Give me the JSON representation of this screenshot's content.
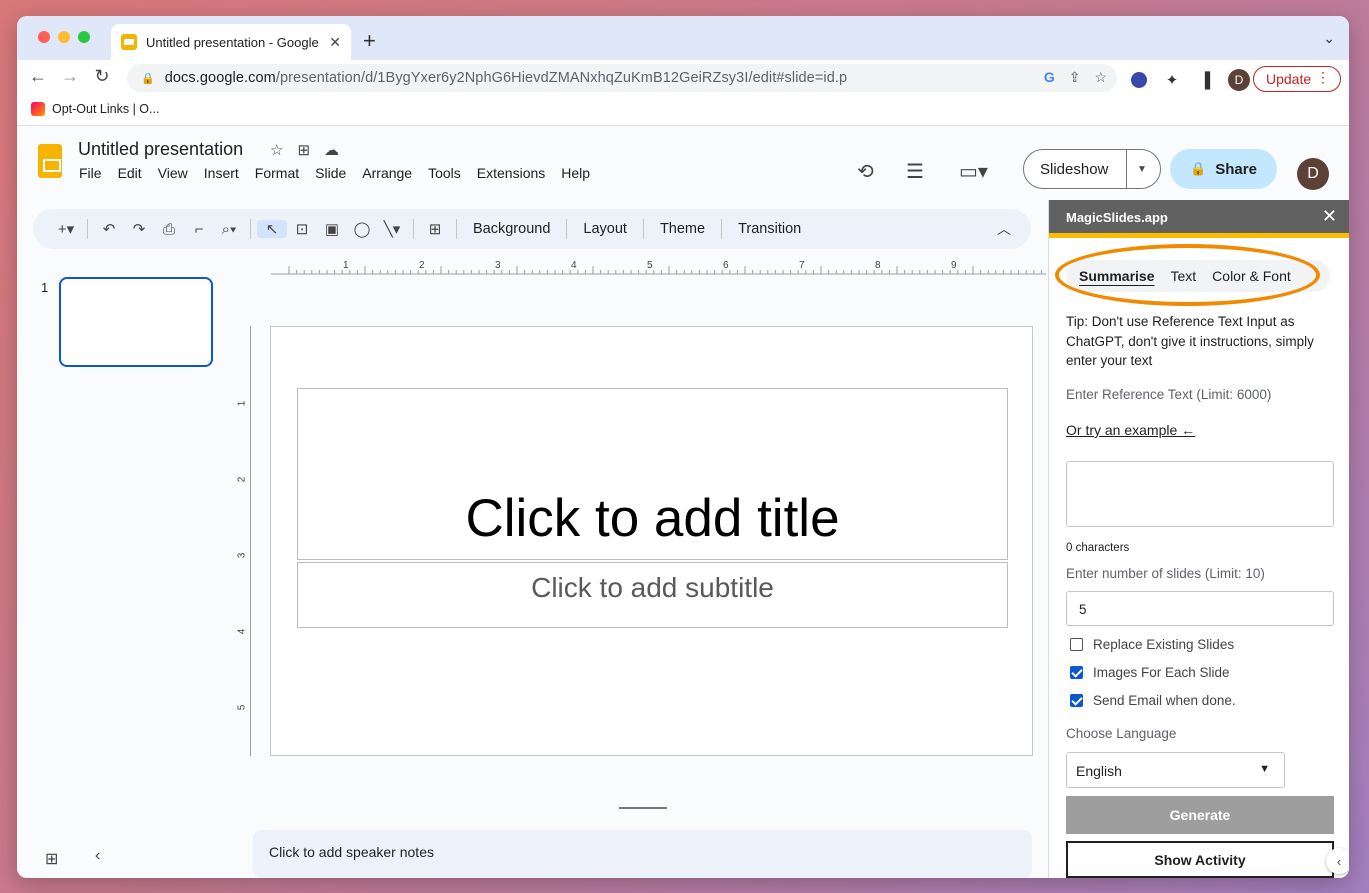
{
  "browser": {
    "tab_title": "Untitled presentation - Google",
    "url_domain": "docs.google.com",
    "url_path": "/presentation/d/1BygYxer6y2NphG6HievdZMANxhqZuKmB12GeiRZsy3I/edit#slide=id.p",
    "update_label": "Update",
    "profile_initial": "D",
    "bookmark_label": "Opt-Out Links | O..."
  },
  "slides": {
    "doc_title": "Untitled presentation",
    "menu": [
      "File",
      "Edit",
      "View",
      "Insert",
      "Format",
      "Slide",
      "Arrange",
      "Tools",
      "Extensions",
      "Help"
    ],
    "slideshow_label": "Slideshow",
    "share_label": "Share",
    "user_initial": "D",
    "toolbar": {
      "background": "Background",
      "layout": "Layout",
      "theme": "Theme",
      "transition": "Transition"
    },
    "slide_number": "1",
    "ruler_h": [
      "1",
      "2",
      "3",
      "4",
      "5",
      "6",
      "7",
      "8",
      "9"
    ],
    "ruler_v": [
      "1",
      "2",
      "3",
      "4",
      "5"
    ],
    "title_placeholder": "Click to add title",
    "subtitle_placeholder": "Click to add subtitle",
    "notes_placeholder": "Click to add speaker notes"
  },
  "panel": {
    "header": "MagicSlides.app",
    "tabs": [
      "Summarise",
      "Text",
      "Color & Font"
    ],
    "tip": "Tip: Don't use Reference Text Input as ChatGPT, don't give it instructions, simply enter your text",
    "ref_label": "Enter Reference Text (Limit: 6000)",
    "example_link": "Or try an example ←",
    "char_count": "0 characters",
    "slides_label": "Enter number of slides (Limit: 10)",
    "slides_value": "5",
    "options": [
      {
        "label": "Replace Existing Slides",
        "checked": false
      },
      {
        "label": "Images For Each Slide",
        "checked": true
      },
      {
        "label": "Send Email when done.",
        "checked": true
      }
    ],
    "language_label": "Choose Language",
    "language_value": "English",
    "generate_label": "Generate",
    "activity_label": "Show Activity"
  },
  "colors": {
    "accent_blue": "#0b57d0",
    "share_bg": "#c2e7ff",
    "highlight": "#f08a00",
    "panel_stripe": "#fbbc04"
  }
}
